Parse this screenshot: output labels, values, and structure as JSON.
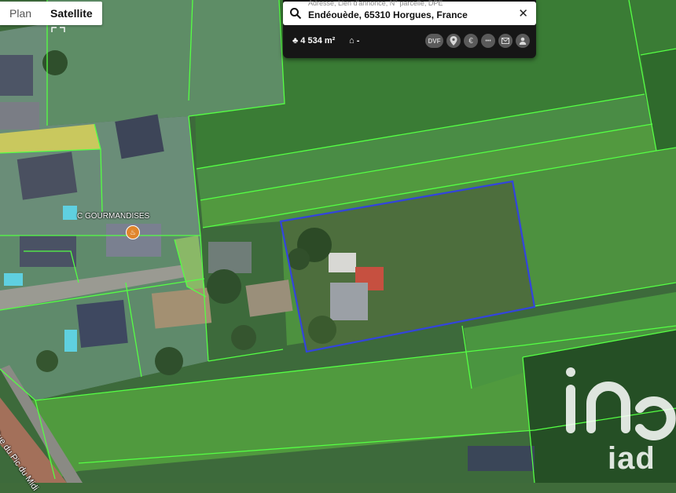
{
  "map_type": {
    "plan_label": "Plan",
    "satellite_label": "Satellite",
    "active": "Satellite"
  },
  "search": {
    "placeholder": "Adresse, Lien d'annonce, N° parcelle, DPE",
    "value": "Endéouède, 65310 Horgues, France",
    "close_icon": "close-icon",
    "search_icon": "search-icon"
  },
  "parcel": {
    "area_icon": "tree-icon",
    "area_label": "4 534 m²",
    "house_icon": "house-icon",
    "house_label": "-"
  },
  "toolbar": {
    "dvf_label": "DVF",
    "icons": [
      "location-pin-icon",
      "euro-icon",
      "more-dots-icon",
      "mail-icon",
      "user-icon"
    ],
    "euro_glyph": "€",
    "dots_glyph": "•••"
  },
  "map_labels": {
    "poi_name": "C GOURMANDISES",
    "poi_icon": "restaurant-icon",
    "street_name": "Rue du Pic du Midi"
  },
  "watermark": {
    "text": "iad"
  },
  "colors": {
    "parcel_outline": "#3344dd",
    "cadastre_lines": "#55ff44",
    "panel_bg": "#161616",
    "poi_pin": "#e0852c"
  }
}
